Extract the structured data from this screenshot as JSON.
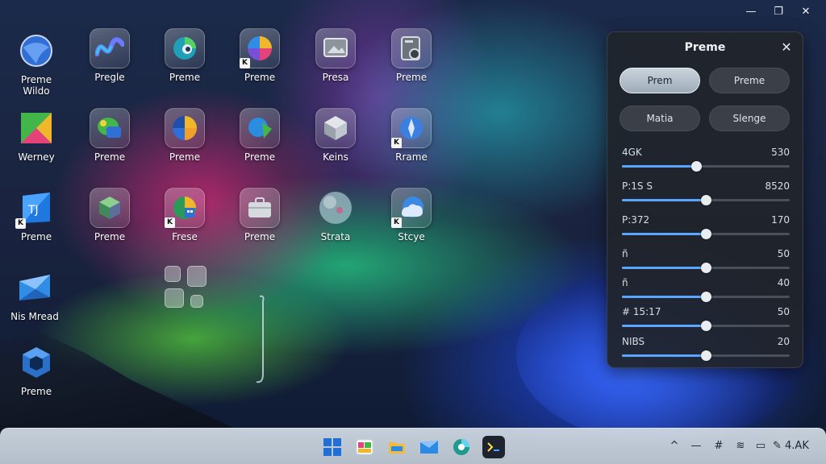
{
  "window_controls": {
    "minimize": "—",
    "restore": "❐",
    "close": "✕"
  },
  "desktop_icons": [
    {
      "label": "Preme\nWildo",
      "icon": "globe-blue-icon",
      "color": "#3a7be0"
    },
    {
      "label": "Pregle",
      "icon": "wave-logo-icon",
      "color": "#5b6cff"
    },
    {
      "label": "Preme",
      "icon": "swirl-icon",
      "color": "#2fb3c9"
    },
    {
      "label": "Preme",
      "icon": "color-wheel-icon",
      "color": "#e45a7a"
    },
    {
      "label": "Presa",
      "icon": "picture-frame-icon",
      "color": "#9aa3ad"
    },
    {
      "label": "Preme",
      "icon": "camera-device-icon",
      "color": "#7b8590"
    },
    {
      "label": "Werney",
      "icon": "prism-icon",
      "color": "#e6a02a"
    },
    {
      "label": "Preme",
      "icon": "paint-blob-icon",
      "color": "#43b649"
    },
    {
      "label": "Preme",
      "icon": "pie-quadrant-icon",
      "color": "#f0b72a"
    },
    {
      "label": "Preme",
      "icon": "paint-bucket-icon",
      "color": "#2b8de0"
    },
    {
      "label": "Keins",
      "icon": "cube-icon",
      "color": "#b8bec6"
    },
    {
      "label": "Rrame",
      "icon": "compass-disc-icon",
      "color": "#3b7fe0"
    },
    {
      "label": "Preme",
      "icon": "shield-logo-icon",
      "color": "#1f78e0"
    },
    {
      "label": "Preme",
      "icon": "box-icon",
      "color": "#5aa36a"
    },
    {
      "label": "Frese",
      "icon": "grid-color-icon",
      "color": "#3ab26a"
    },
    {
      "label": "Preme",
      "icon": "briefcase-icon",
      "color": "#c7c9cf"
    },
    {
      "label": "Strata",
      "icon": "orb-icon",
      "color": "#b6d0d8"
    },
    {
      "label": "Stcye",
      "icon": "cloud-disc-icon",
      "color": "#3a8ae5"
    },
    {
      "label": "Nis Mread",
      "icon": "envelope-3d-icon",
      "color": "#2f8de6"
    },
    {
      "label": "Preme",
      "icon": "hexagon-logo-icon",
      "color": "#2a6fc8"
    }
  ],
  "panel": {
    "title": "Preme",
    "close": "✕",
    "buttons": [
      {
        "label": "Prem",
        "active": true
      },
      {
        "label": "Preme",
        "active": false
      },
      {
        "label": "Matia",
        "active": false
      },
      {
        "label": "Slenge",
        "active": false
      }
    ],
    "sliders": [
      {
        "label": "4GK",
        "value": "530",
        "level": 0.44
      },
      {
        "label": "P:1S S",
        "value": "8520",
        "level": 0.5
      },
      {
        "label": "P:372",
        "value": "170",
        "level": 0.5
      },
      {
        "label": "ñ",
        "value": "50",
        "level": 0.5
      },
      {
        "label": "ñ",
        "value": "40",
        "level": 0.5
      },
      {
        "label": "# 15:17",
        "value": "50",
        "level": 0.5
      },
      {
        "label": "NIBS",
        "value": "20",
        "level": 0.5
      }
    ]
  },
  "taskbar": {
    "apps": [
      {
        "name": "start-icon",
        "color": "#1f6fd6"
      },
      {
        "name": "gallery-icon",
        "color": "#e8a23a"
      },
      {
        "name": "file-explorer-icon",
        "color": "#f2b93b"
      },
      {
        "name": "mail-icon",
        "color": "#2a8be6"
      },
      {
        "name": "browser-icon",
        "color": "#1e9a8f"
      },
      {
        "name": "terminal-icon",
        "color": "#1d2430"
      }
    ],
    "tray": {
      "chevron": "^",
      "dash": "—",
      "network": "#",
      "volume": "≋",
      "battery": "▭",
      "clock": "4.AK"
    }
  }
}
